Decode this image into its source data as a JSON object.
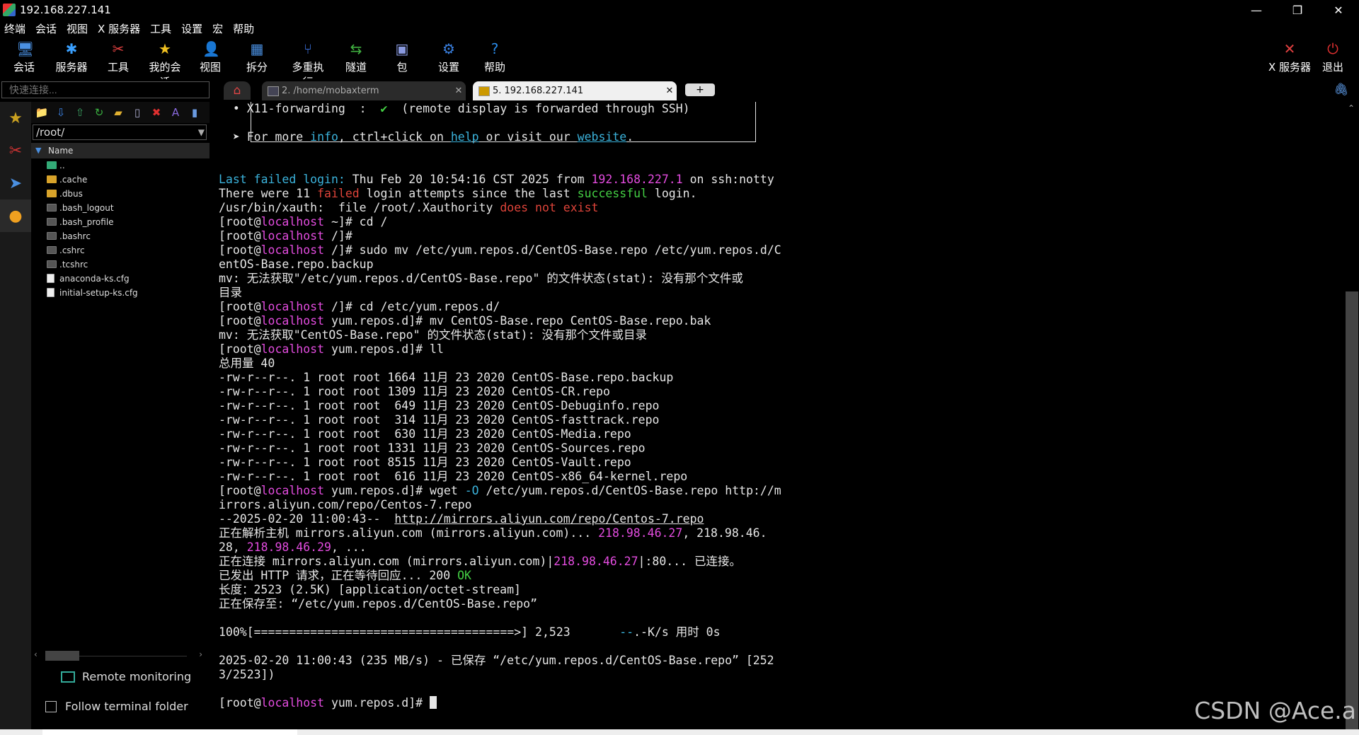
{
  "window": {
    "title": "192.168.227.141"
  },
  "menu": [
    "终端",
    "会话",
    "视图",
    "X 服务器",
    "工具",
    "设置",
    "宏",
    "帮助"
  ],
  "toolbar": [
    {
      "label": "会话",
      "icon": "session-icon",
      "color": "#4a90e2",
      "glyph": "🖥"
    },
    {
      "label": "服务器",
      "icon": "servers-icon",
      "color": "#3aa0ff",
      "glyph": "✱"
    },
    {
      "label": "工具",
      "icon": "tools-icon",
      "color": "#e04040",
      "glyph": "✂"
    },
    {
      "label": "我的会话",
      "icon": "star-icon",
      "color": "#f0c020",
      "glyph": "★"
    },
    {
      "label": "视图",
      "icon": "view-icon",
      "color": "#8ab",
      "glyph": "👤"
    },
    {
      "label": "拆分",
      "icon": "split-icon",
      "color": "#4a90e2",
      "glyph": "▦"
    },
    {
      "label": "多重执行",
      "icon": "multiexec-icon",
      "color": "#3a6fd8",
      "glyph": "⑂"
    },
    {
      "label": "隧道",
      "icon": "tunnel-icon",
      "color": "#40b040",
      "glyph": "⇆"
    },
    {
      "label": "包",
      "icon": "packages-icon",
      "color": "#8a9ae0",
      "glyph": "▣"
    },
    {
      "label": "设置",
      "icon": "settings-icon",
      "color": "#3a80e0",
      "glyph": "⚙"
    },
    {
      "label": "帮助",
      "icon": "help-icon",
      "color": "#2a8ae8",
      "glyph": "?"
    }
  ],
  "toolbar_right": [
    {
      "label": "X 服务器",
      "icon": "xserver-icon",
      "color": "#e04040",
      "glyph": "✕"
    },
    {
      "label": "退出",
      "icon": "exit-icon",
      "color": "#e03030",
      "glyph": "⏻"
    }
  ],
  "quick_connect": {
    "placeholder": "快速连接..."
  },
  "tabs": [
    {
      "label": "2. /home/mobaxterm",
      "active": false
    },
    {
      "label": "5. 192.168.227.141",
      "active": true
    }
  ],
  "file_browser": {
    "path": "/root/",
    "column": "Name",
    "items": [
      {
        "name": "..",
        "type": "up"
      },
      {
        "name": ".cache",
        "type": "folder"
      },
      {
        "name": ".dbus",
        "type": "folder"
      },
      {
        "name": ".bash_logout",
        "type": "file"
      },
      {
        "name": ".bash_profile",
        "type": "file"
      },
      {
        "name": ".bashrc",
        "type": "file"
      },
      {
        "name": ".cshrc",
        "type": "file"
      },
      {
        "name": ".tcshrc",
        "type": "file"
      },
      {
        "name": "anaconda-ks.cfg",
        "type": "doc"
      },
      {
        "name": "initial-setup-ks.cfg",
        "type": "doc"
      }
    ],
    "remote_monitoring": "Remote monitoring",
    "follow_folder": "Follow terminal folder"
  },
  "terminal": {
    "lines": [
      [
        {
          "t": "  • X11-forwarding  :  "
        },
        {
          "t": "✔",
          "c": "gr"
        },
        {
          "t": "  (remote display is forwarded through SSH)"
        }
      ],
      [],
      [
        {
          "t": "  ➤ For more "
        },
        {
          "t": "info",
          "c": "cy"
        },
        {
          "t": ", ctrl+click on "
        },
        {
          "t": "help",
          "c": "cy",
          "u": true
        },
        {
          "t": " or visit our "
        },
        {
          "t": "website",
          "c": "cy",
          "u": true
        },
        {
          "t": "."
        }
      ],
      [],
      [],
      [
        {
          "t": "Last failed login:",
          "c": "cy"
        },
        {
          "t": " Thu Feb 20 10:54:16 CST 2025 from "
        },
        {
          "t": "192.168.227.1",
          "c": "mg"
        },
        {
          "t": " on ssh:notty"
        }
      ],
      [
        {
          "t": "There were 11 "
        },
        {
          "t": "failed",
          "c": "rd"
        },
        {
          "t": " login attempts since the last "
        },
        {
          "t": "successful",
          "c": "gr"
        },
        {
          "t": " login."
        }
      ],
      [
        {
          "t": "/usr/bin/xauth:  file /root/.Xauthority "
        },
        {
          "t": "does not exist",
          "c": "rd"
        }
      ],
      [
        {
          "t": "[root@"
        },
        {
          "t": "localhost",
          "c": "mg"
        },
        {
          "t": " ~]# cd /"
        }
      ],
      [
        {
          "t": "[root@"
        },
        {
          "t": "localhost",
          "c": "mg"
        },
        {
          "t": " /]#"
        }
      ],
      [
        {
          "t": "[root@"
        },
        {
          "t": "localhost",
          "c": "mg"
        },
        {
          "t": " /]# sudo mv /etc/yum.repos.d/CentOS-Base.repo /etc/yum.repos.d/C"
        }
      ],
      [
        {
          "t": "entOS-Base.repo.backup"
        }
      ],
      [
        {
          "t": "mv: 无法获取\"/etc/yum.repos.d/CentOS-Base.repo\" 的文件状态(stat): 没有那个文件或"
        }
      ],
      [
        {
          "t": "目录"
        }
      ],
      [
        {
          "t": "[root@"
        },
        {
          "t": "localhost",
          "c": "mg"
        },
        {
          "t": " /]# cd /etc/yum.repos.d/"
        }
      ],
      [
        {
          "t": "[root@"
        },
        {
          "t": "localhost",
          "c": "mg"
        },
        {
          "t": " yum.repos.d]# mv CentOS-Base.repo CentOS-Base.repo.bak"
        }
      ],
      [
        {
          "t": "mv: 无法获取\"CentOS-Base.repo\" 的文件状态(stat): 没有那个文件或目录"
        }
      ],
      [
        {
          "t": "[root@"
        },
        {
          "t": "localhost",
          "c": "mg"
        },
        {
          "t": " yum.repos.d]# ll"
        }
      ],
      [
        {
          "t": "总用量 40"
        }
      ],
      [
        {
          "t": "-rw-r--r--. 1 root root 1664 11月 23 2020 CentOS-Base.repo.backup"
        }
      ],
      [
        {
          "t": "-rw-r--r--. 1 root root 1309 11月 23 2020 CentOS-CR.repo"
        }
      ],
      [
        {
          "t": "-rw-r--r--. 1 root root  649 11月 23 2020 CentOS-Debuginfo.repo"
        }
      ],
      [
        {
          "t": "-rw-r--r--. 1 root root  314 11月 23 2020 CentOS-fasttrack.repo"
        }
      ],
      [
        {
          "t": "-rw-r--r--. 1 root root  630 11月 23 2020 CentOS-Media.repo"
        }
      ],
      [
        {
          "t": "-rw-r--r--. 1 root root 1331 11月 23 2020 CentOS-Sources.repo"
        }
      ],
      [
        {
          "t": "-rw-r--r--. 1 root root 8515 11月 23 2020 CentOS-Vault.repo"
        }
      ],
      [
        {
          "t": "-rw-r--r--. 1 root root  616 11月 23 2020 CentOS-x86_64-kernel.repo"
        }
      ],
      [
        {
          "t": "[root@"
        },
        {
          "t": "localhost",
          "c": "mg"
        },
        {
          "t": " yum.repos.d]# wget "
        },
        {
          "t": "-O",
          "c": "cy"
        },
        {
          "t": " /etc/yum.repos.d/CentOS-Base.repo http://m"
        }
      ],
      [
        {
          "t": "irrors.aliyun.com/repo/Centos-7.repo"
        }
      ],
      [
        {
          "t": "--2025-02-20 11:00:43--  "
        },
        {
          "t": "http://mirrors.aliyun.com/repo/Centos-7.repo",
          "u": true
        }
      ],
      [
        {
          "t": "正在解析主机 mirrors.aliyun.com (mirrors.aliyun.com)... "
        },
        {
          "t": "218.98.46.27",
          "c": "mg"
        },
        {
          "t": ", 218.98.46."
        }
      ],
      [
        {
          "t": "28, "
        },
        {
          "t": "218.98.46.29",
          "c": "mg"
        },
        {
          "t": ", ..."
        }
      ],
      [
        {
          "t": "正在连接 mirrors.aliyun.com (mirrors.aliyun.com)|"
        },
        {
          "t": "218.98.46.27",
          "c": "mg"
        },
        {
          "t": "|:80... 已连接。"
        }
      ],
      [
        {
          "t": "已发出 HTTP 请求，正在等待回应... 200 "
        },
        {
          "t": "OK",
          "c": "gr"
        }
      ],
      [
        {
          "t": "长度：2523 (2.5K) [application/octet-stream]"
        }
      ],
      [
        {
          "t": "正在保存至: “/etc/yum.repos.d/CentOS-Base.repo”"
        }
      ],
      [],
      [
        {
          "t": "100%[=====================================>] 2,523       "
        },
        {
          "t": "--",
          "c": "cy"
        },
        {
          "t": ".-K/s 用时 0s"
        }
      ],
      [],
      [
        {
          "t": "2025-02-20 11:00:43 (235 MB/s) - 已保存 “/etc/yum.repos.d/CentOS-Base.repo” [252"
        }
      ],
      [
        {
          "t": "3/2523])"
        }
      ],
      [],
      [
        {
          "t": "[root@"
        },
        {
          "t": "localhost",
          "c": "mg"
        },
        {
          "t": " yum.repos.d]# "
        },
        {
          "t": "",
          "cursor": true
        }
      ]
    ]
  },
  "watermark": "CSDN @Ace.a"
}
